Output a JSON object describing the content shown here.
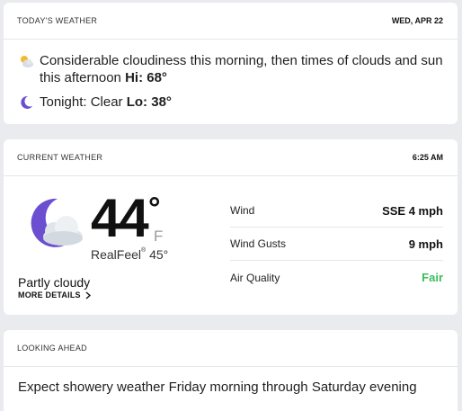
{
  "today": {
    "title": "TODAY'S WEATHER",
    "date": "WED, APR 22",
    "day_text": "Considerable cloudiness this morning, then times of clouds and sun this afternoon",
    "day_hi_label": "Hi: 68°",
    "day_icon": "partly-sunny-icon",
    "night_text": "Tonight: Clear",
    "night_lo_label": "Lo: 38°",
    "night_icon": "crescent-moon-icon"
  },
  "current": {
    "title": "CURRENT WEATHER",
    "time": "6:25 AM",
    "temperature": "44",
    "degree": "°",
    "unit": "F",
    "realfeel_label": "RealFeel",
    "realfeel_mark": "®",
    "realfeel_value": "45°",
    "condition": "Partly cloudy",
    "more_details": "MORE DETAILS",
    "icon": "moon-with-cloud-icon",
    "metrics": [
      {
        "label": "Wind",
        "value": "SSE 4 mph"
      },
      {
        "label": "Wind Gusts",
        "value": "9 mph"
      },
      {
        "label": "Air Quality",
        "value": "Fair"
      }
    ],
    "colors": {
      "air_quality_fair": "#3bbd5b",
      "moon": "#6b4fd0"
    }
  },
  "ahead": {
    "title": "LOOKING AHEAD",
    "text": "Expect showery weather Friday morning through Saturday evening"
  }
}
